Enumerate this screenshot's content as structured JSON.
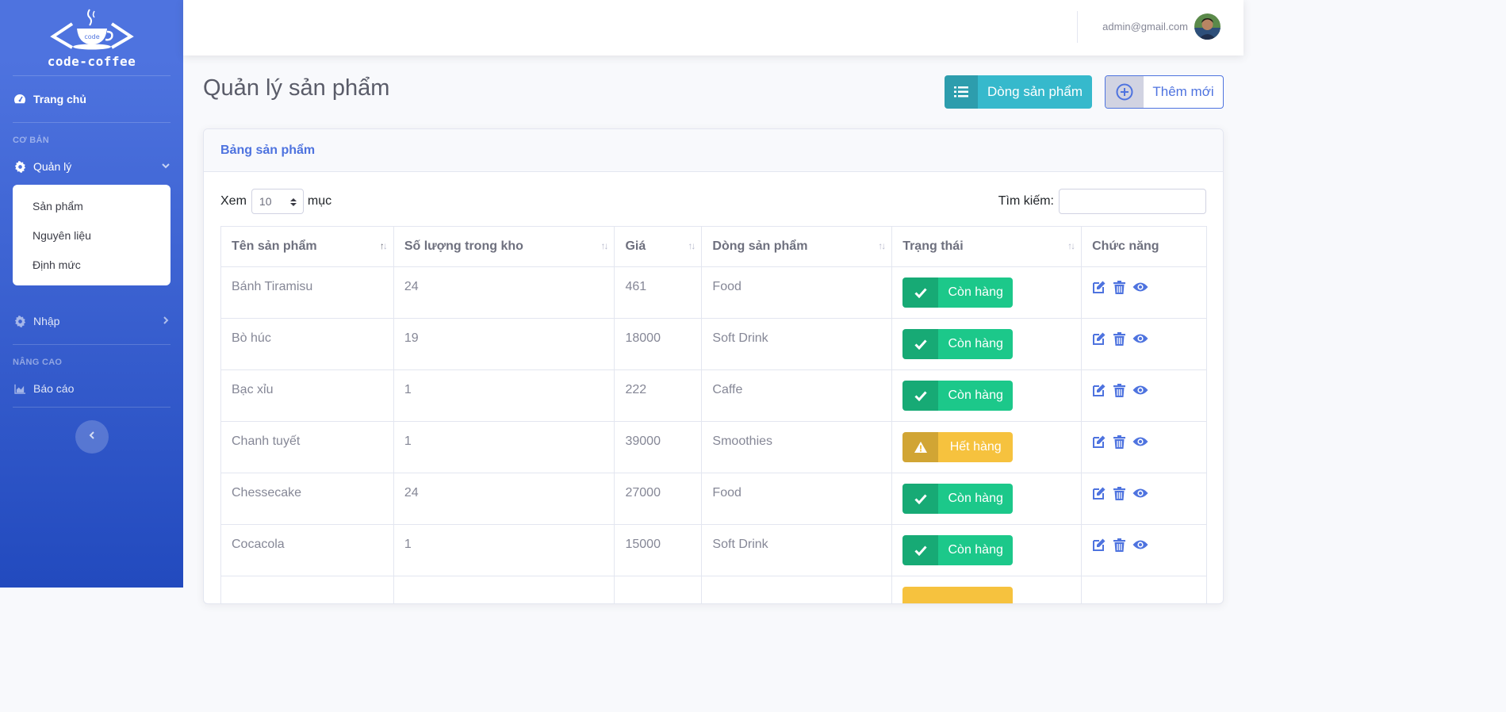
{
  "brand": {
    "logo_text": "code",
    "name": "code-coffee"
  },
  "sidebar": {
    "home_label": "Trang chủ",
    "heading_basic": "CƠ BẢN",
    "manage_label": "Quản lý",
    "submenu": [
      "Sản phẩm",
      "Nguyên liệu",
      "Định mức"
    ],
    "import_label": "Nhập",
    "heading_advanced": "NÂNG CAO",
    "report_label": "Báo cáo"
  },
  "topbar": {
    "user_email": "admin@gmail.com"
  },
  "page": {
    "title": "Quản lý sản phẩm",
    "btn_product_lines": "Dòng sản phẩm",
    "btn_add_new": "Thêm mới"
  },
  "card": {
    "title": "Bảng sản phẩm",
    "show_label": "Xem",
    "page_length": "10",
    "entries_label": "mục",
    "search_label": "Tìm kiếm:"
  },
  "table": {
    "headers": [
      "Tên sản phẩm",
      "Số lượng trong kho",
      "Giá",
      "Dòng sản phẩm",
      "Trạng thái",
      "Chức năng"
    ],
    "rows": [
      {
        "name": "Bánh Tiramisu",
        "qty": "24",
        "price": "461",
        "line": "Food",
        "status": "Còn hàng",
        "status_type": "ok"
      },
      {
        "name": "Bò húc",
        "qty": "19",
        "price": "18000",
        "line": "Soft Drink",
        "status": "Còn hàng",
        "status_type": "ok"
      },
      {
        "name": "Bạc xỉu",
        "qty": "1",
        "price": "222",
        "line": "Caffe",
        "status": "Còn hàng",
        "status_type": "ok"
      },
      {
        "name": "Chanh tuyết",
        "qty": "1",
        "price": "39000",
        "line": "Smoothies",
        "status": "Hết hàng",
        "status_type": "out"
      },
      {
        "name": "Chessecake",
        "qty": "24",
        "price": "27000",
        "line": "Food",
        "status": "Còn hàng",
        "status_type": "ok"
      },
      {
        "name": "Cocacola",
        "qty": "1",
        "price": "15000",
        "line": "Soft Drink",
        "status": "Còn hàng",
        "status_type": "ok"
      }
    ]
  },
  "colors": {
    "primary": "#4e73df",
    "info": "#36b9cc",
    "success": "#1cc88a",
    "warning": "#f6c23e"
  }
}
